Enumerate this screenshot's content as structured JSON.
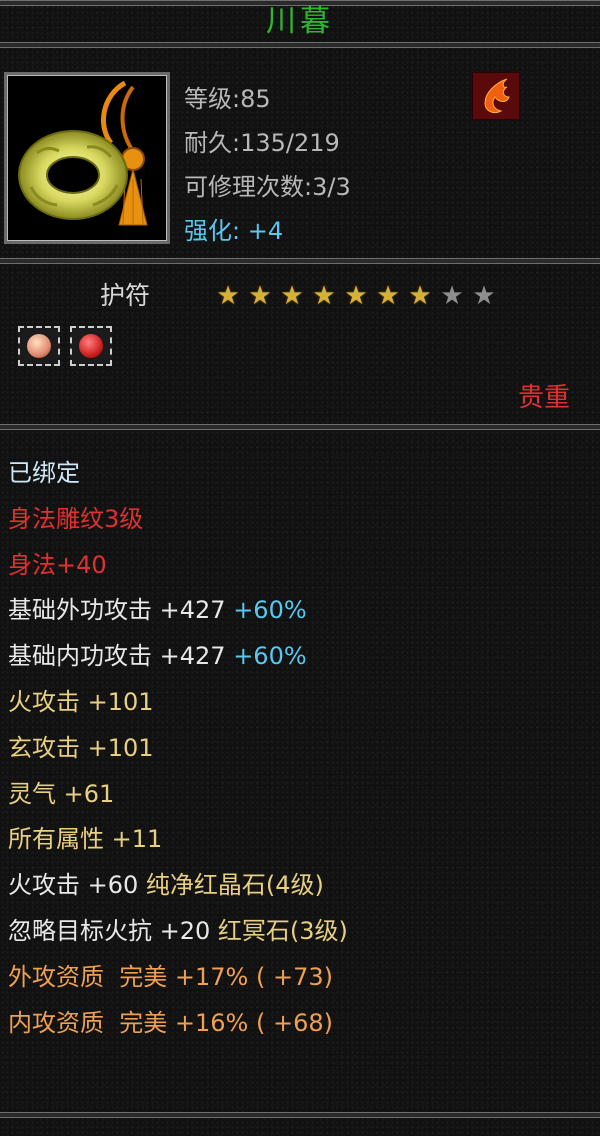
{
  "item": {
    "name": "川暮",
    "level": "等级:85",
    "durability": "耐久:135/219",
    "repair": "可修理次数:3/3",
    "enhance_label": "强化:",
    "enhance_value": "+4",
    "type": "护符",
    "stars": {
      "lit": 7,
      "total": 9
    },
    "rarity": "贵重",
    "badge_icon": "fire-element-icon",
    "item_icon": "jade-ring-amulet-icon"
  },
  "gems": [
    {
      "name": "gem-slot-1",
      "color": "#e0a080"
    },
    {
      "name": "gem-slot-2",
      "color": "#d02020"
    }
  ],
  "attributes": [
    {
      "parts": [
        {
          "text": "已绑定",
          "color": "#cfe8f8"
        }
      ]
    },
    {
      "parts": [
        {
          "text": "身法雕纹3级",
          "color": "#e03030"
        }
      ]
    },
    {
      "parts": [
        {
          "text": "身法+40",
          "color": "#e03030"
        }
      ]
    },
    {
      "parts": [
        {
          "text": "基础外功攻击 +427 ",
          "color": "#e8e8e8"
        },
        {
          "text": "+60%",
          "color": "#58c8f0"
        }
      ]
    },
    {
      "parts": [
        {
          "text": "基础内功攻击 +427 ",
          "color": "#e8e8e8"
        },
        {
          "text": "+60%",
          "color": "#58c8f0"
        }
      ]
    },
    {
      "parts": [
        {
          "text": "火攻击 +101",
          "color": "#e8d080"
        }
      ]
    },
    {
      "parts": [
        {
          "text": "玄攻击 +101",
          "color": "#e8d080"
        }
      ]
    },
    {
      "parts": [
        {
          "text": "灵气 +61",
          "color": "#e8d080"
        }
      ]
    },
    {
      "parts": [
        {
          "text": "所有属性 +11",
          "color": "#e8d080"
        }
      ]
    },
    {
      "parts": [
        {
          "text": "火攻击 +60 ",
          "color": "#e8e8e8"
        },
        {
          "text": "纯净红晶石(4级)",
          "color": "#e8d080"
        }
      ]
    },
    {
      "parts": [
        {
          "text": "忽略目标火抗 +20 ",
          "color": "#e8e8e8"
        },
        {
          "text": "红冥石(3级)",
          "color": "#e8d080"
        }
      ]
    },
    {
      "parts": [
        {
          "text": "外攻资质  完美 +17% ( +73)",
          "color": "#f0a050"
        }
      ]
    },
    {
      "parts": [
        {
          "text": "内攻资质  完美 +16% ( +68)",
          "color": "#f0a050"
        }
      ]
    }
  ]
}
